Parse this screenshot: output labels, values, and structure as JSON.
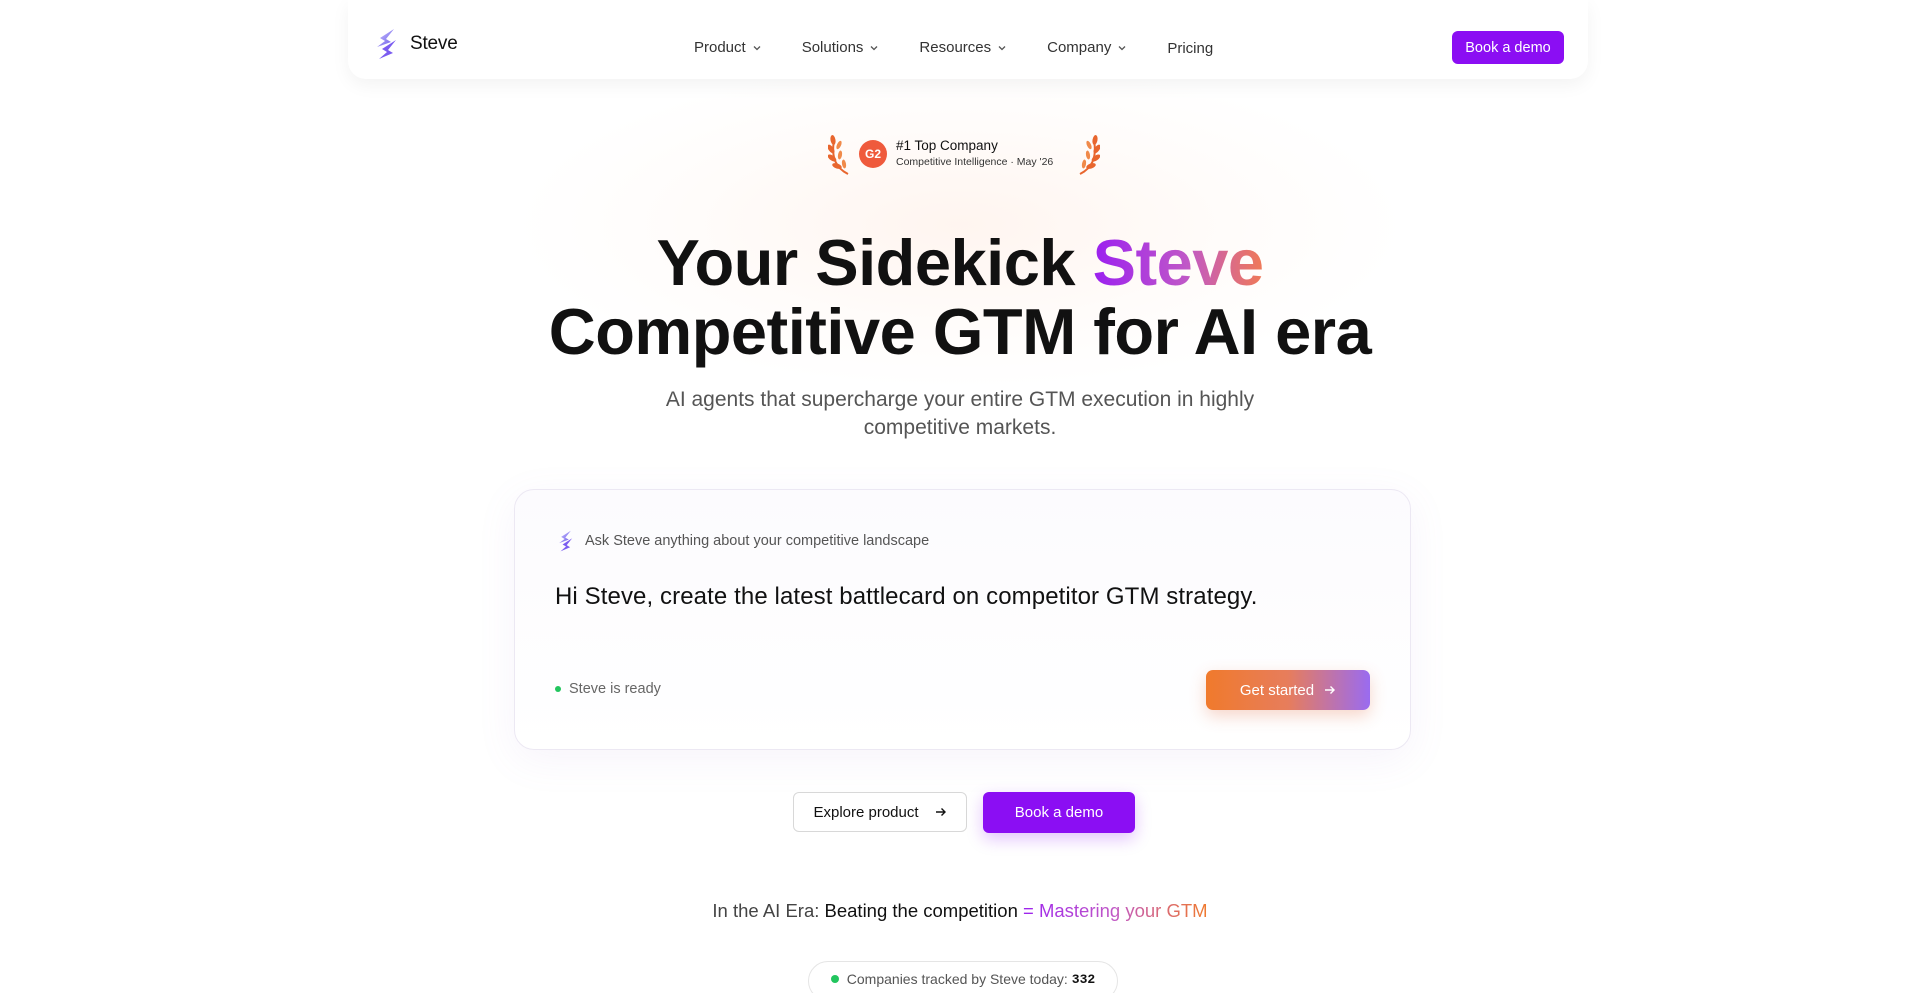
{
  "nav": {
    "brand": "Steve",
    "items": [
      {
        "label": "Product",
        "has_dropdown": true
      },
      {
        "label": "Solutions",
        "has_dropdown": true
      },
      {
        "label": "Resources",
        "has_dropdown": true
      },
      {
        "label": "Company",
        "has_dropdown": true
      },
      {
        "label": "Pricing",
        "has_dropdown": false
      }
    ],
    "cta": "Book a demo"
  },
  "badge": {
    "logo": "G2",
    "title": "#1 Top Company",
    "subtitle": "Competitive Intelligence · May '26"
  },
  "hero": {
    "title_line1_pre": "Your Sidekick ",
    "title_line1_accent": "Steve",
    "title_line2": "Competitive GTM for AI era",
    "subtitle": "AI agents that supercharge your entire GTM execution in highly competitive markets."
  },
  "card": {
    "label": "Ask Steve anything about your competitive landscape",
    "prompt": "Hi Steve, create the latest battlecard on competitor GTM strategy.",
    "status": "Steve is ready",
    "button": "Get started"
  },
  "cta": {
    "explore": "Explore product",
    "demo": "Book a demo"
  },
  "tagline": {
    "pre": "In the AI Era: ",
    "mid": "Beating the competition",
    "accent": " = Mastering your GTM"
  },
  "counter": {
    "label": "Companies tracked by Steve today:",
    "value": "332"
  },
  "colors": {
    "primary": "#8b0ef3",
    "accent_orange": "#f07a2c",
    "status_green": "#22c55e"
  }
}
